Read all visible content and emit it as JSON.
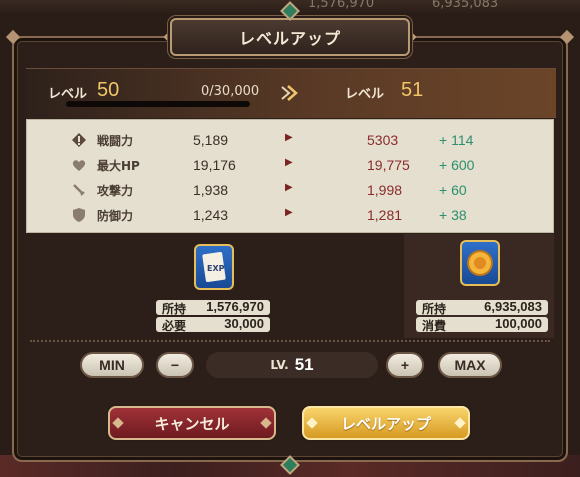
{
  "background": {
    "top_left_value": "1,576,970",
    "top_right_value": "6,935,083"
  },
  "dialog": {
    "title": "レベルアップ"
  },
  "level": {
    "label_current": "レベル",
    "current": "50",
    "exp": "0/30,000",
    "exp_progress": 0,
    "label_next": "レベル",
    "next": "51"
  },
  "stats": [
    {
      "icon": "combat-power-icon",
      "name": "戦闘力",
      "current": "5,189",
      "new": "5303",
      "diff": "+ 114"
    },
    {
      "icon": "heart-icon",
      "name": "最大HP",
      "current": "19,176",
      "new": "19,775",
      "diff": "+ 600"
    },
    {
      "icon": "sword-icon",
      "name": "攻撃力",
      "current": "1,938",
      "new": "1,998",
      "diff": "+ 60"
    },
    {
      "icon": "shield-icon",
      "name": "防御力",
      "current": "1,243",
      "new": "1,281",
      "diff": "+ 38"
    }
  ],
  "resources": {
    "exp_item": {
      "icon": "exp-card-icon",
      "icon_text": "EXP",
      "owned_label": "所持",
      "owned": "1,576,970",
      "required_label": "必要",
      "required": "30,000"
    },
    "gold": {
      "icon": "gold-coin-icon",
      "owned_label": "所持",
      "owned": "6,935,083",
      "cost_label": "消費",
      "cost": "100,000"
    }
  },
  "controls": {
    "min": "MIN",
    "minus": "−",
    "lv_prefix": "LV.",
    "lv_value": "51",
    "plus": "+",
    "max": "MAX"
  },
  "buttons": {
    "cancel": "キャンセル",
    "confirm": "レベルアップ"
  },
  "colors": {
    "accent_gold": "#f0c66a",
    "stat_increase": "#2c8f6f",
    "stat_new": "#8b2c2c",
    "cancel_red": "#a03238",
    "confirm_yellow": "#f8d46c"
  }
}
